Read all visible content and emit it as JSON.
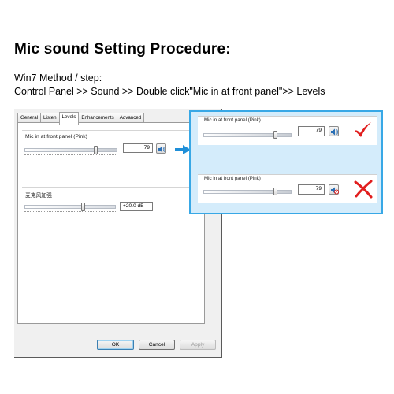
{
  "page": {
    "title": "Mic sound Setting Procedure:",
    "method": "Win7 Method / step:",
    "path": "Control Panel >> Sound >> Double click\"Mic in at front panel\">> Levels"
  },
  "dialog": {
    "tabs": [
      {
        "label": "General",
        "active": false
      },
      {
        "label": "Listen",
        "active": false
      },
      {
        "label": "Levels",
        "active": true
      },
      {
        "label": "Enhancements",
        "active": false
      },
      {
        "label": "Advanced",
        "active": false
      }
    ],
    "mic": {
      "label": "Mic in at front panel (Pink)",
      "value": "79",
      "level_percent": 79,
      "muted": false
    },
    "boost": {
      "label": "麦克风加强",
      "value": "+20.0 dB",
      "level_fraction": 0.67
    },
    "buttons": {
      "ok": "OK",
      "cancel": "Cancel",
      "apply": "Apply"
    }
  },
  "callout": {
    "correct": {
      "label": "Mic in at front panel (Pink)",
      "value": "79",
      "level_percent": 79,
      "muted": false,
      "status": "correct"
    },
    "wrong": {
      "label": "Mic in at front panel (Pink)",
      "value": "79",
      "level_percent": 79,
      "muted": true,
      "status": "wrong"
    }
  },
  "colors": {
    "callout_border": "#38a8e6",
    "callout_bg": "#d4ecfb",
    "arrow": "#1f8fd8",
    "check": "#e11e1e",
    "cross": "#e11e1e",
    "default_button_border": "#3c7fb1"
  },
  "icons": {
    "speaker": "speaker-icon",
    "speaker_muted": "speaker-muted-icon",
    "check": "check-mark-icon",
    "cross": "cross-mark-icon",
    "arrow": "arrow-right-icon"
  }
}
